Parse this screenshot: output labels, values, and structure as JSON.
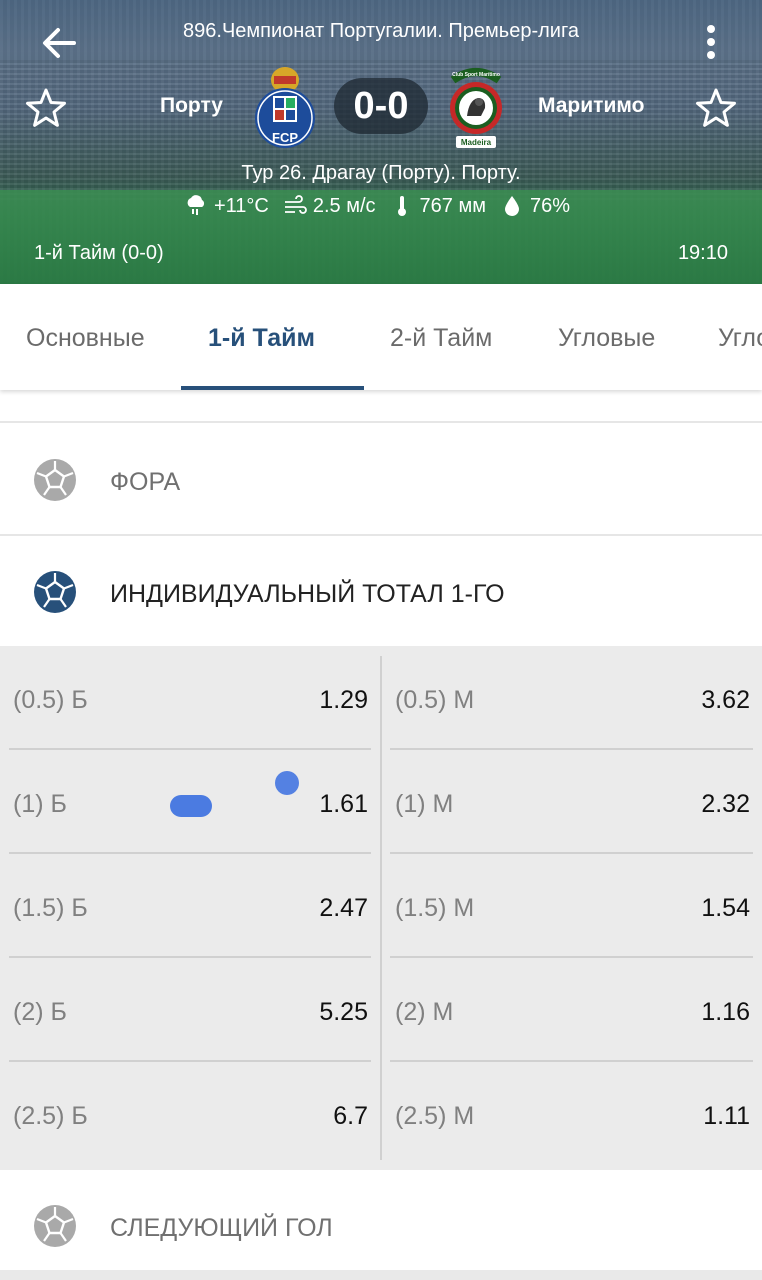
{
  "header": {
    "league": "896.Чемпионат Португалии. Премьер-лига",
    "home_team": "Порту",
    "away_team": "Маритимо",
    "score": "0-0",
    "round_info": "Тур 26. Драгау (Порту). Порту.",
    "weather": {
      "temperature": "+11°C",
      "wind": "2.5 м/с",
      "pressure": "767 мм",
      "humidity": "76%"
    },
    "period": "1-й  Тайм (0-0)",
    "time": "19:10",
    "home_logo_text": "FCP",
    "away_logo_text": "Madeira",
    "away_logo_arc_text": "Club Sport Marítimo"
  },
  "tabs": [
    "Основные",
    "1-й  Тайм",
    "2-й  Тайм",
    "Угловые",
    "Угловые"
  ],
  "active_tab_index": 1,
  "sections": {
    "fora": "ФОРА",
    "individual_total": "ИНДИВИДУАЛЬНЫЙ ТОТАЛ 1-ГО",
    "next_goal": "СЛЕДУЮЩИЙ ГОЛ"
  },
  "odds": [
    {
      "over_label": "(0.5) Б",
      "over_value": "1.29",
      "under_label": "(0.5) М",
      "under_value": "3.62"
    },
    {
      "over_label": "(1) Б",
      "over_value": "1.61",
      "under_label": "(1) М",
      "under_value": "2.32"
    },
    {
      "over_label": "(1.5) Б",
      "over_value": "2.47",
      "under_label": "(1.5) М",
      "under_value": "1.54"
    },
    {
      "over_label": "(2) Б",
      "over_value": "5.25",
      "under_label": "(2) М",
      "under_value": "1.16"
    },
    {
      "over_label": "(2.5) Б",
      "over_value": "6.7",
      "under_label": "(2.5) М",
      "under_value": "1.11"
    }
  ],
  "icons": {
    "back": "arrow-left-icon",
    "menu": "more-vert-icon",
    "favorite": "star-outline-icon",
    "weather": "cloud-rain-icon",
    "wind": "wind-icon",
    "thermometer": "thermometer-icon",
    "humidity": "droplet-icon",
    "section": "soccer-ball-icon"
  },
  "colors": {
    "accent": "#27507a",
    "ball_collapsed": "#a9a9a9",
    "ball_expanded": "#27507a",
    "odds_bg": "#ebebeb"
  }
}
